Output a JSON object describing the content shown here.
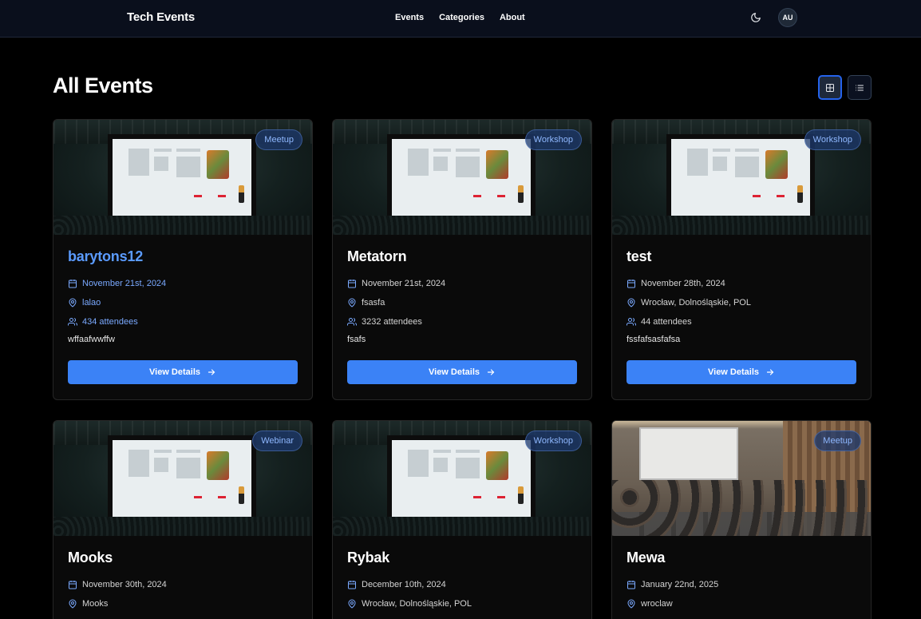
{
  "header": {
    "brand": "Tech Events",
    "nav": [
      "Events",
      "Categories",
      "About"
    ],
    "theme_icon": "moon-icon",
    "avatar_initials": "AU"
  },
  "page": {
    "title": "All Events",
    "view_grid_icon": "grid-icon",
    "view_list_icon": "list-icon"
  },
  "colors": {
    "accent": "#3b82f6",
    "accent_text": "#5b9bff",
    "background": "#000000",
    "card": "#0a0a0a"
  },
  "events": [
    {
      "category": "Meetup",
      "title": "barytons12",
      "date": "November 21st, 2024",
      "location": "lalao",
      "attendees": "434 attendees",
      "description": "wffaafwwffw",
      "cta": "View Details",
      "highlighted": true,
      "image": "stage"
    },
    {
      "category": "Workshop",
      "title": "Metatorn",
      "date": "November 21st, 2024",
      "location": "fsasfa",
      "attendees": "3232 attendees",
      "description": "fsafs",
      "cta": "View Details",
      "highlighted": false,
      "image": "stage"
    },
    {
      "category": "Workshop",
      "title": "test",
      "date": "November 28th, 2024",
      "location": "Wrocław, Dolnośląskie, POL",
      "attendees": "44 attendees",
      "description": "fssfafsasfafsa",
      "cta": "View Details",
      "highlighted": false,
      "image": "stage"
    },
    {
      "category": "Webinar",
      "title": "Mooks",
      "date": "November 30th, 2024",
      "location": "Mooks",
      "image": "stage"
    },
    {
      "category": "Workshop",
      "title": "Rybak",
      "date": "December 10th, 2024",
      "location": "Wrocław, Dolnośląskie, POL",
      "image": "stage"
    },
    {
      "category": "Meetup",
      "title": "Mewa",
      "date": "January 22nd, 2025",
      "location": "wroclaw",
      "image": "room"
    }
  ]
}
